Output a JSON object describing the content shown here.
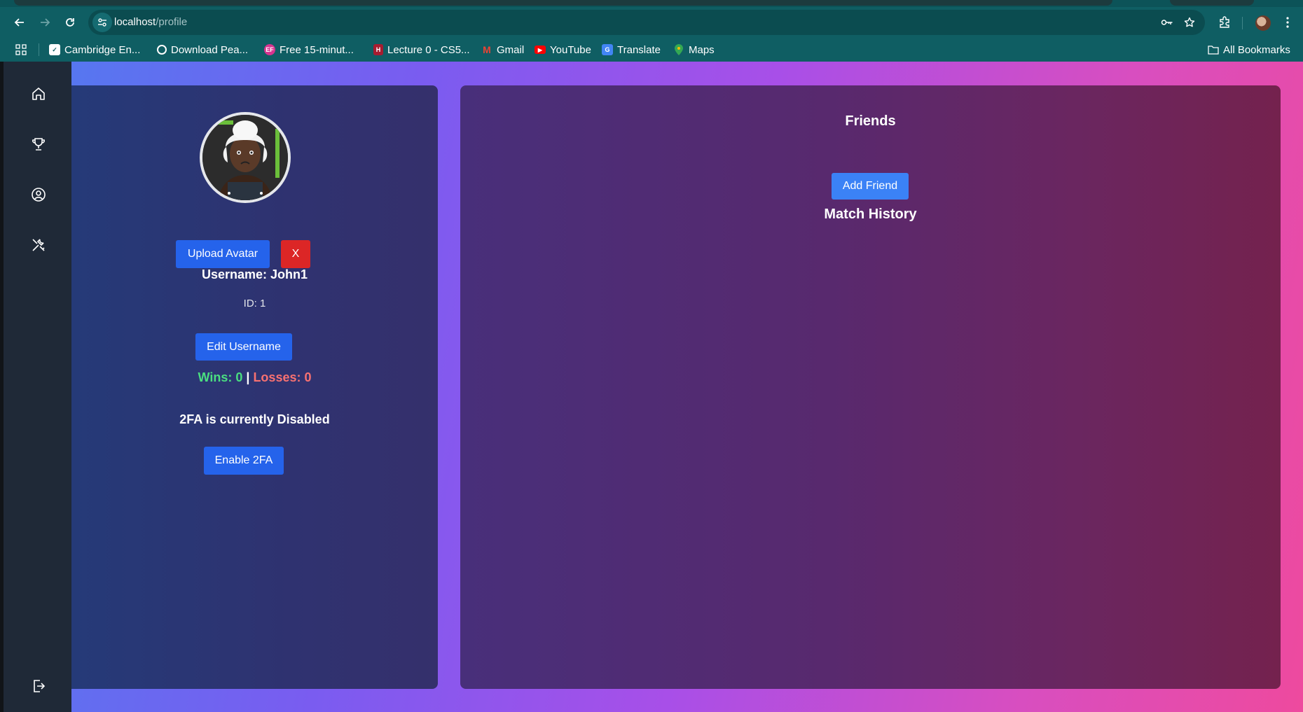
{
  "browser": {
    "url_host": "localhost",
    "url_path": "/profile",
    "bookmarks": [
      {
        "label": "Cambridge En...",
        "icon": "checkbox-icon"
      },
      {
        "label": "Download Pea...",
        "icon": "globe-icon"
      },
      {
        "label": "Free 15-minut...",
        "icon": "ef-icon"
      },
      {
        "label": "Lecture 0 - CS5...",
        "icon": "harvard-icon"
      },
      {
        "label": "Gmail",
        "icon": "gmail-icon"
      },
      {
        "label": "YouTube",
        "icon": "youtube-icon"
      },
      {
        "label": "Translate",
        "icon": "translate-icon"
      },
      {
        "label": "Maps",
        "icon": "maps-icon"
      }
    ],
    "all_bookmarks": "All Bookmarks"
  },
  "sidebar": {
    "items": [
      {
        "name": "home",
        "icon": "home-icon"
      },
      {
        "name": "leaderboard",
        "icon": "trophy-icon"
      },
      {
        "name": "profile",
        "icon": "user-circle-icon"
      },
      {
        "name": "settings",
        "icon": "tools-icon"
      }
    ],
    "logout_icon": "logout-icon"
  },
  "profile": {
    "upload_avatar_label": "Upload Avatar",
    "remove_avatar_label": "X",
    "username_text": "Username: John1",
    "id_text": "ID: 1",
    "edit_username_label": "Edit Username",
    "wins_text": "Wins: 0",
    "separator": "|",
    "losses_text": "Losses: 0",
    "twofa_status": "2FA is currently Disabled",
    "enable_2fa_label": "Enable 2FA"
  },
  "social": {
    "friends_title": "Friends",
    "add_friend_label": "Add Friend",
    "match_history_title": "Match History"
  },
  "colors": {
    "button_blue": "#2563eb",
    "button_red": "#dc2626",
    "wins_green": "#4ade80",
    "losses_red": "#f87171",
    "sidebar_bg": "#1f2937"
  }
}
